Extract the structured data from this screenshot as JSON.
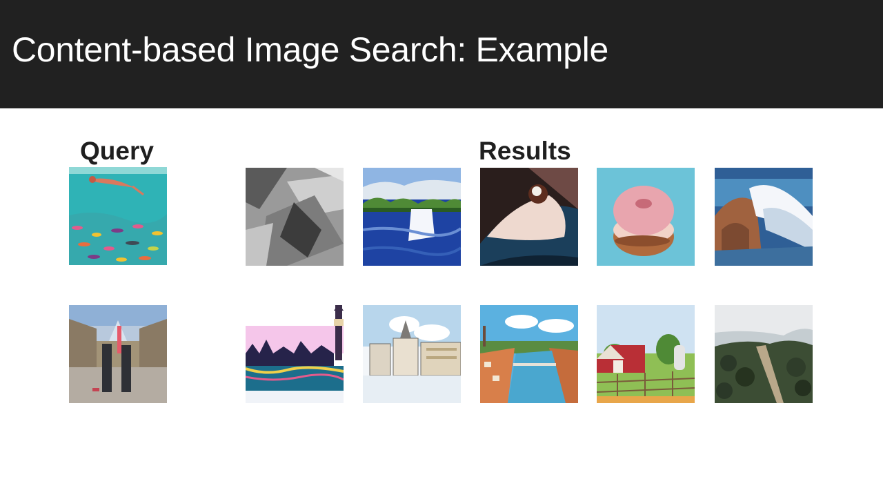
{
  "slide": {
    "title": "Content-based Image Search: Example",
    "query_heading": "Query",
    "results_heading": "Results",
    "rows": [
      {
        "query": "painting-underwater-swimmer-fish",
        "results": [
          "painting-grayscale-abstract",
          "painting-lake-boat-trees",
          "painting-pastry-cream",
          "painting-pink-donut",
          "painting-ocean-wave-rocks"
        ]
      },
      {
        "query": "photo-louvre-courtyard-figures",
        "results": [
          "painting-london-skyline-big-ben",
          "painting-city-square-cathedral",
          "painting-river-town-bridge",
          "painting-red-barn-vineyard",
          "painting-hilltop-forest-town"
        ]
      }
    ]
  }
}
